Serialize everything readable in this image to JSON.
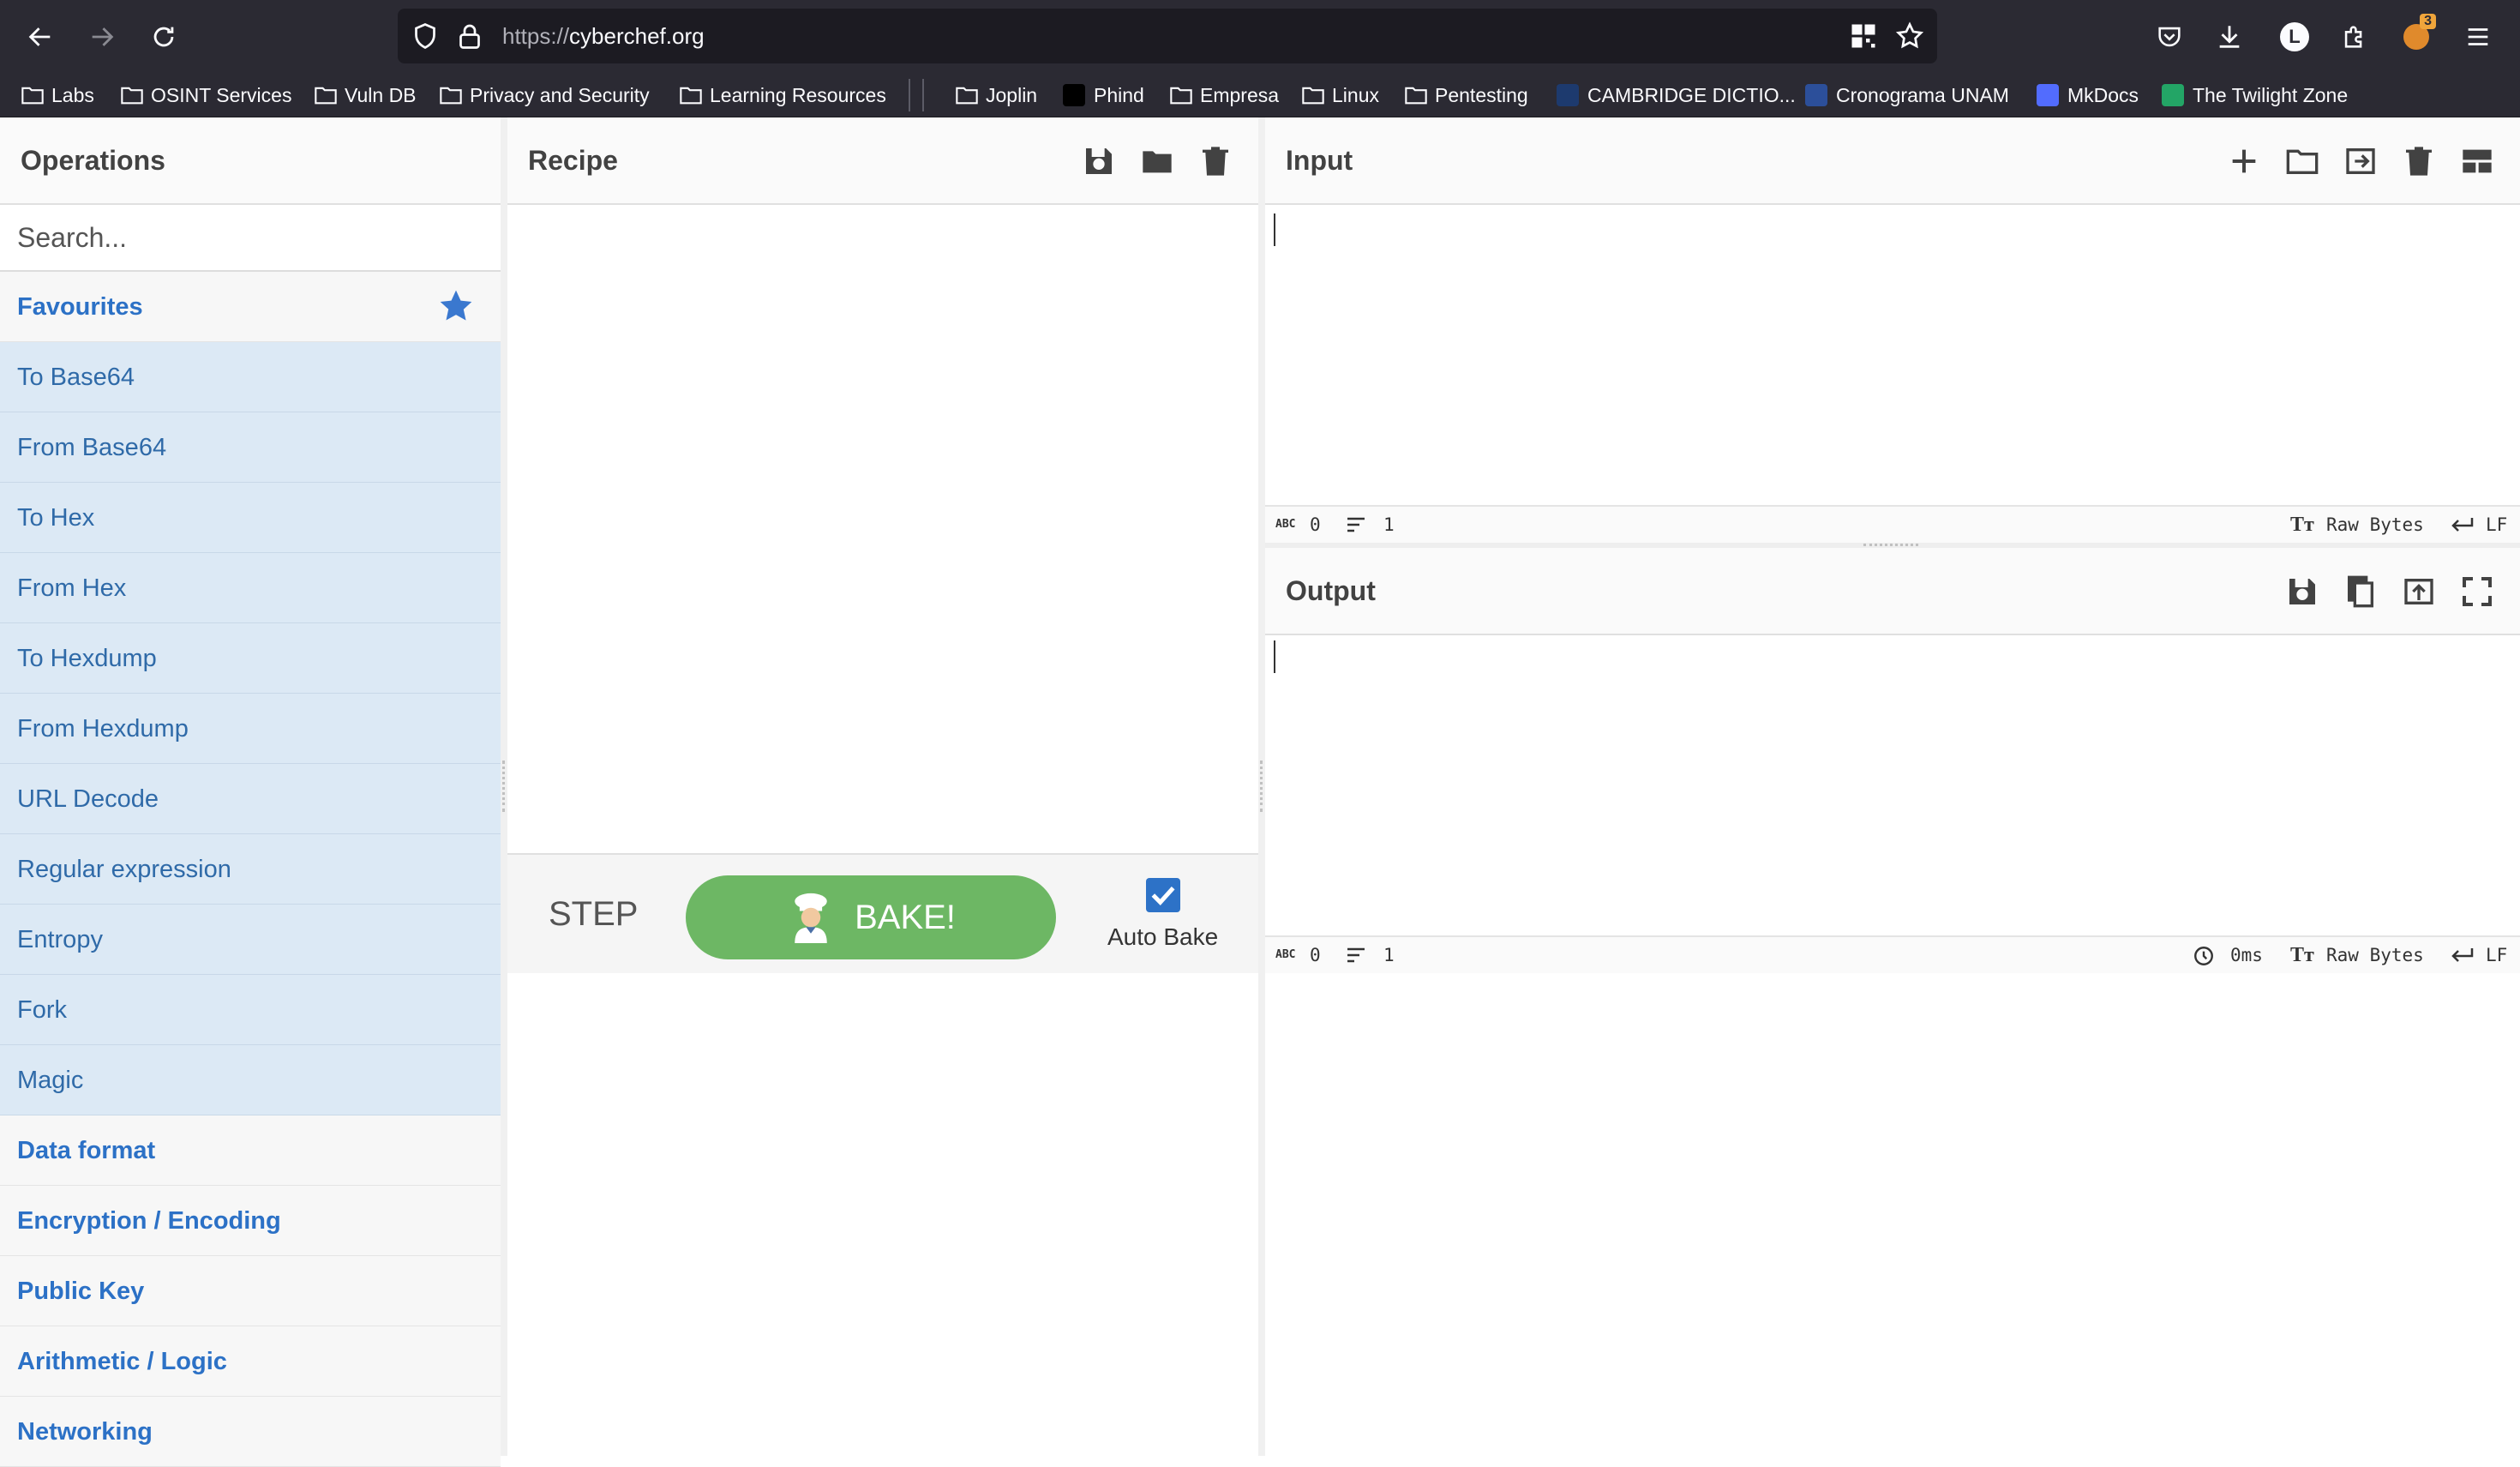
{
  "browser": {
    "url_scheme": "https://",
    "url_host": "cyberchef.org",
    "extensions_badge": "3",
    "account_initial": "L",
    "bookmarks": [
      {
        "label": "Labs",
        "icon": "folder-icon"
      },
      {
        "label": "OSINT Services",
        "icon": "folder-icon"
      },
      {
        "label": "Vuln DB",
        "icon": "folder-icon"
      },
      {
        "label": "Privacy and Security",
        "icon": "folder-icon"
      },
      {
        "label": "Learning Resources",
        "icon": "folder-icon"
      },
      {
        "label": "Joplin",
        "icon": "folder-icon"
      },
      {
        "label": "Phind",
        "icon": "phind-favicon"
      },
      {
        "label": "Empresa",
        "icon": "folder-icon"
      },
      {
        "label": "Linux",
        "icon": "folder-icon"
      },
      {
        "label": "Pentesting",
        "icon": "folder-icon"
      },
      {
        "label": "CAMBRIDGE DICTIO...",
        "icon": "cambridge-favicon"
      },
      {
        "label": "Cronograma UNAM",
        "icon": "unam-favicon"
      },
      {
        "label": "MkDocs",
        "icon": "mkdocs-favicon"
      },
      {
        "label": "The Twilight Zone",
        "icon": "sheets-favicon"
      }
    ]
  },
  "operations": {
    "title": "Operations",
    "search_placeholder": "Search...",
    "favourites_label": "Favourites",
    "favourites": [
      "To Base64",
      "From Base64",
      "To Hex",
      "From Hex",
      "To Hexdump",
      "From Hexdump",
      "URL Decode",
      "Regular expression",
      "Entropy",
      "Fork",
      "Magic"
    ],
    "categories": [
      "Data format",
      "Encryption / Encoding",
      "Public Key",
      "Arithmetic / Logic",
      "Networking"
    ]
  },
  "recipe": {
    "title": "Recipe",
    "step_label": "STEP",
    "bake_label": "BAKE!",
    "auto_bake_label": "Auto Bake",
    "auto_bake_checked": true
  },
  "input": {
    "title": "Input",
    "status_chars": "0",
    "status_lines": "1",
    "status_encoding": "Raw Bytes",
    "status_eol": "LF"
  },
  "output": {
    "title": "Output",
    "status_chars": "0",
    "status_lines": "1",
    "status_time": "0ms",
    "status_encoding": "Raw Bytes",
    "status_eol": "LF"
  },
  "colors": {
    "browser_bg": "#2b2a33",
    "favourite_bg": "#dce9f5",
    "category_text": "#2c71c6",
    "bake_green": "#6db764",
    "checkbox_blue": "#2d72c7"
  }
}
